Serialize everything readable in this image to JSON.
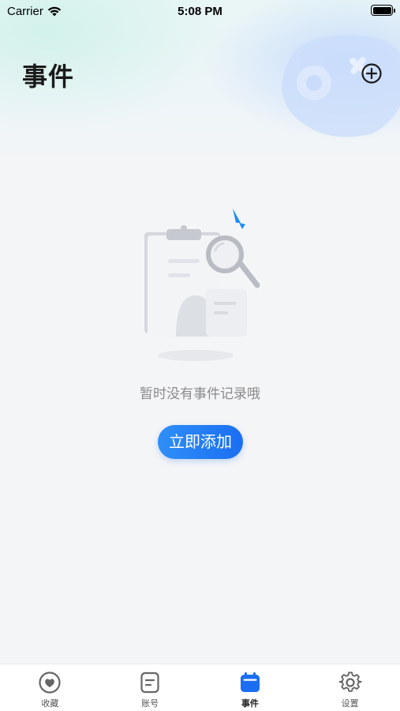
{
  "status_bar": {
    "carrier": "Carrier",
    "time": "5:08 PM"
  },
  "header": {
    "title": "事件",
    "add_icon": "plus-circle-icon"
  },
  "empty_state": {
    "message": "暂时没有事件记录哦",
    "button_label": "立即添加"
  },
  "tabbar": {
    "active_color": "#1b6ef2",
    "items": [
      {
        "label": "收藏",
        "icon": "heart-icon"
      },
      {
        "label": "账号",
        "icon": "document-icon"
      },
      {
        "label": "事件",
        "icon": "calendar-icon"
      },
      {
        "label": "设置",
        "icon": "gear-icon"
      }
    ]
  }
}
